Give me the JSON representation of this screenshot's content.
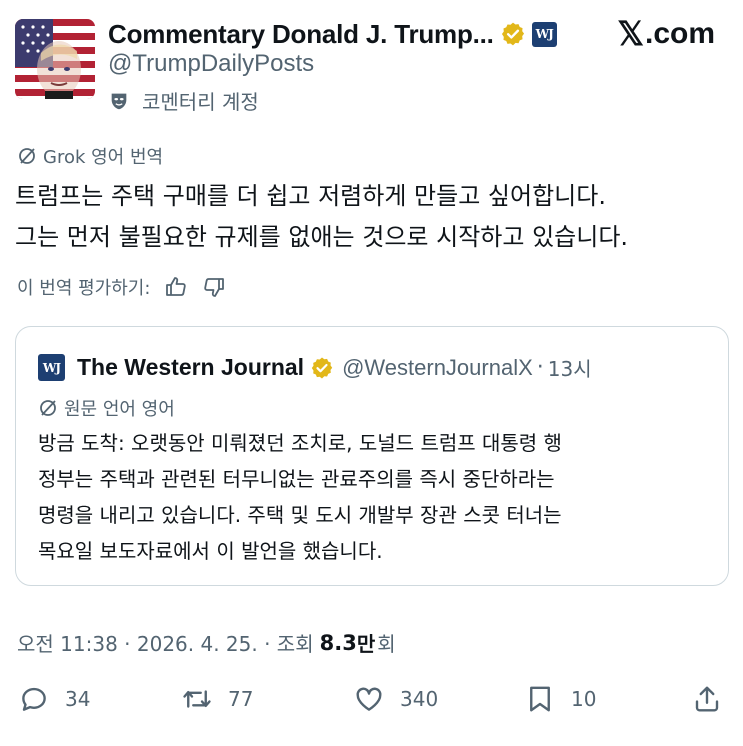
{
  "header": {
    "display_name": "Commentary Donald J. Trump...",
    "badge_text": "WJ",
    "handle": "@TrumpDailyPosts",
    "account_type": "코멘터리 계정",
    "site_brand": "com",
    "site_brand_logo": "𝕏"
  },
  "translation": {
    "label": "Grok 영어 번역",
    "tweet_lines": [
      "트럼프는 주택 구매를 더 쉽고 저렴하게 만들고 싶어합니다.",
      "그는 먼저 불필요한 규제를 없애는 것으로 시작하고 있습니다."
    ],
    "rate_label": "이 번역 평가하기:"
  },
  "quote": {
    "badge_text": "WJ",
    "name": "The Western Journal",
    "handle": "@WesternJournalX",
    "separator": "·",
    "time": "13시",
    "lang_label": "원문 언어 영어",
    "lines": [
      "방금 도착: 오랫동안 미뤄졌던 조치로, 도널드 트럼프 대통령 행",
      "정부는 주택과 관련된 터무니없는 관료주의를 즉시 중단하라는",
      "명령을 내리고 있습니다. 주택 및 도시 개발부 장관 스콧 터너는",
      "목요일 보도자료에서 이 발언을 했습니다."
    ]
  },
  "meta": {
    "time_date": "오전 11:38 · 2026. 4. 25. · 조회",
    "views_number": "8.3",
    "views_unit": "만",
    "views_label": "회"
  },
  "actions": {
    "replies": "34",
    "reposts": "77",
    "likes": "340",
    "bookmarks": "10"
  },
  "colors": {
    "text_primary": "#0f1419",
    "text_secondary": "#536471",
    "verified_gold": "#e2b719",
    "wj_badge": "#1d3f72",
    "border": "#cfd9de"
  },
  "icons": [
    "avatar-image",
    "verified-gold-icon",
    "wj-badge",
    "x-logo",
    "commentary-mask-icon",
    "translate-slash-icon",
    "thumbs-up-icon",
    "thumbs-down-icon",
    "reply-icon",
    "repost-icon",
    "like-icon",
    "bookmark-icon",
    "share-icon"
  ]
}
